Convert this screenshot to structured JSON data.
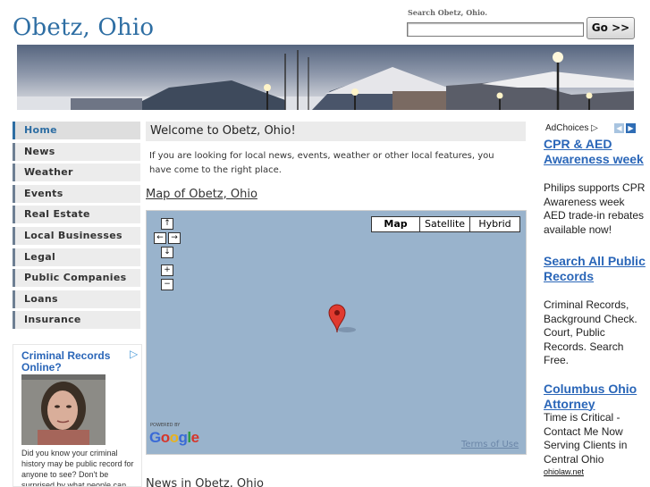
{
  "header": {
    "site_title": "Obetz, Ohio",
    "search_label": "Search Obetz, Ohio.",
    "search_value": "",
    "go_button": "Go >>"
  },
  "nav": {
    "items": [
      {
        "label": "Home",
        "active": true
      },
      {
        "label": "News"
      },
      {
        "label": "Weather"
      },
      {
        "label": "Events"
      },
      {
        "label": "Real Estate"
      },
      {
        "label": "Local Businesses"
      },
      {
        "label": "Legal"
      },
      {
        "label": "Public Companies"
      },
      {
        "label": "Loans"
      },
      {
        "label": "Insurance"
      }
    ]
  },
  "left_ad": {
    "title": "Criminal Records Online?",
    "text": "Did you know your criminal history may be public record for anyone to see? Don't be surprised by what people can"
  },
  "main": {
    "welcome": "Welcome to Obetz, Ohio!",
    "intro": "If you are looking for local news, events, weather or other local features, you have come to the right place.",
    "map_heading": "Map of Obetz, Ohio",
    "news_heading": "News in Obetz, Ohio"
  },
  "map": {
    "types": [
      "Map",
      "Satellite",
      "Hybrid"
    ],
    "active_type": "Map",
    "pan_up": "↑",
    "pan_left": "←",
    "pan_right": "→",
    "pan_down": "↓",
    "zoom_in": "+",
    "zoom_out": "−",
    "powered_by": "POWERED BY",
    "logo": "Google",
    "terms": "Terms of Use",
    "colors": {
      "water": "#99b3cc",
      "marker": "#e03a2f"
    }
  },
  "right_ads": {
    "adchoices": "AdChoices",
    "prev": "◀",
    "next": "▶",
    "ads": [
      {
        "title": "CPR & AED Awareness week",
        "body": "Philips supports CPR Awareness week AED trade-in rebates available now!"
      },
      {
        "title": "Search All Public Records",
        "body": "Criminal Records, Background Check. Court, Public Records. Search Free."
      },
      {
        "title": "Columbus Ohio Attorney",
        "body": "Time is Critical - Contact Me Now Serving Clients in Central Ohio",
        "url": "ohiolaw.net"
      }
    ]
  },
  "colors": {
    "brand": "#2e6ea3",
    "ad_link": "#2a66b8",
    "nav_bg": "#ececec"
  }
}
